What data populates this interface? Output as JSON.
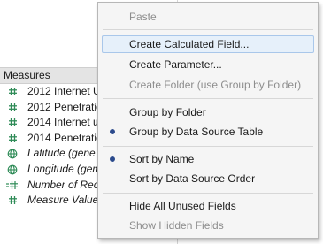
{
  "data_pane": {
    "measures_header": "Measures",
    "fields": [
      {
        "label": "2012 Internet U",
        "icon": "measure-hash-icon",
        "italic": false
      },
      {
        "label": "2012 Penetratio",
        "icon": "measure-hash-icon",
        "italic": false
      },
      {
        "label": "2014 Internet u",
        "icon": "measure-hash-icon",
        "italic": false
      },
      {
        "label": "2014 Penetratio",
        "icon": "measure-hash-icon",
        "italic": false
      },
      {
        "label": "Latitude (gene",
        "icon": "globe-icon",
        "italic": true
      },
      {
        "label": "Longitude (gen",
        "icon": "globe-icon",
        "italic": true
      },
      {
        "label": "Number of Reco",
        "icon": "measure-hash-equals-icon",
        "italic": true
      },
      {
        "label": "Measure Value",
        "icon": "measure-hash-icon",
        "italic": true
      }
    ]
  },
  "context_menu": {
    "paste": "Paste",
    "create_calculated_field": "Create Calculated Field...",
    "create_parameter": "Create Parameter...",
    "create_folder": "Create Folder (use Group by Folder)",
    "group_by_folder": "Group by Folder",
    "group_by_data_source_table": "Group by Data Source Table",
    "sort_by_name": "Sort by Name",
    "sort_by_data_source_order": "Sort by Data Source Order",
    "hide_all_unused_fields": "Hide All Unused Fields",
    "show_hidden_fields": "Show Hidden Fields"
  },
  "colors": {
    "measure_icon": "#2e8b57",
    "radio_selected": "#2b4a8c",
    "highlight_bg": "#e6f0fa",
    "highlight_border": "#a9c7ea"
  }
}
